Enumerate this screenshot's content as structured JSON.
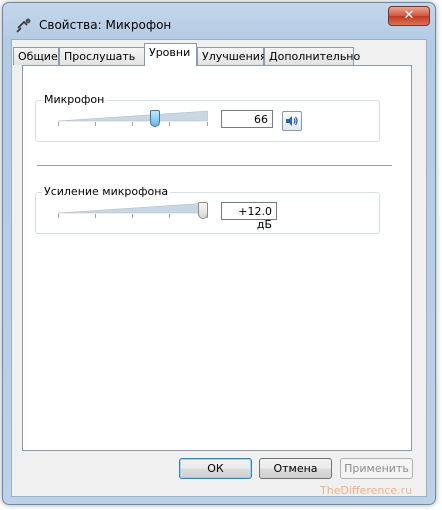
{
  "window": {
    "title": "Свойства: Микрофон",
    "close_symbol": "✕"
  },
  "tabs": [
    {
      "label": "Общие",
      "active": false
    },
    {
      "label": "Прослушать",
      "active": false
    },
    {
      "label": "Уровни",
      "active": true
    },
    {
      "label": "Улучшения",
      "active": false
    },
    {
      "label": "Дополнительно",
      "active": false
    }
  ],
  "levels": {
    "microphone": {
      "label": "Микрофон",
      "value": "66",
      "level": 0.66
    },
    "boost": {
      "label": "Усиление микрофона",
      "value": "+12.0 дБ",
      "level": 1.0
    }
  },
  "buttons": {
    "ok": "ОК",
    "cancel": "Отмена",
    "apply": "Применить"
  },
  "watermark": {
    "brand": "TheDifference",
    "tld": ".ru"
  },
  "colors": {
    "slider_thumb": "#7cc4ee",
    "boost_thumb": "#e8e8e8",
    "title_bar": "#b9cee6"
  }
}
